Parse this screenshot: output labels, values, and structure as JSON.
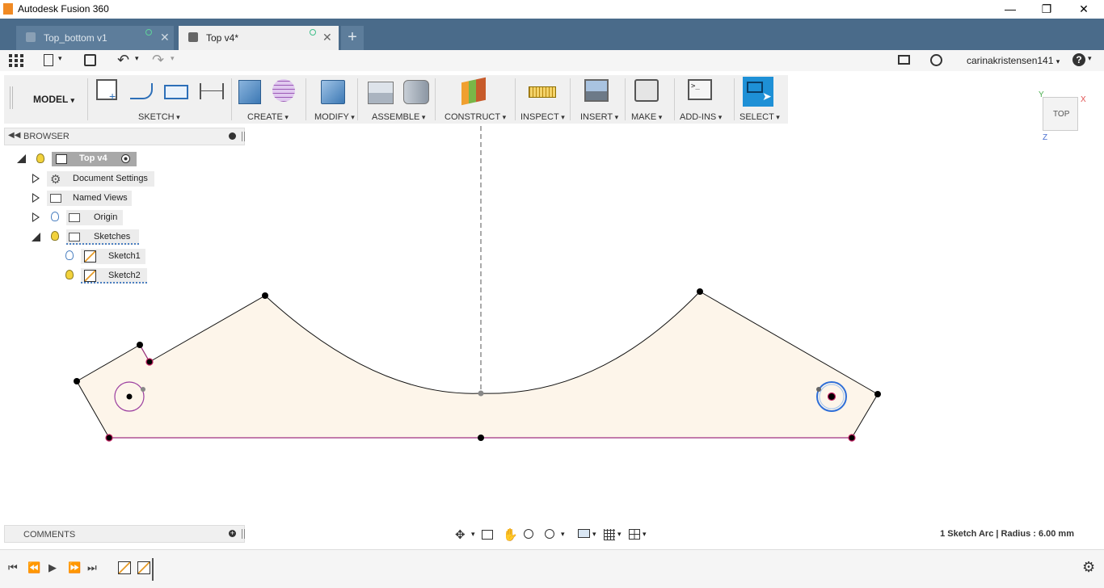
{
  "window": {
    "title": "Autodesk Fusion 360"
  },
  "tabs": [
    {
      "label": "Top_bottom v1",
      "active": false
    },
    {
      "label": "Top v4*",
      "active": true
    }
  ],
  "user": {
    "name": "carinakristensen141"
  },
  "workspace": {
    "label": "MODEL"
  },
  "ribbon": {
    "groups": [
      "SKETCH",
      "CREATE",
      "MODIFY",
      "ASSEMBLE",
      "CONSTRUCT",
      "INSPECT",
      "INSERT",
      "MAKE",
      "ADD-INS",
      "SELECT"
    ]
  },
  "viewcube": {
    "face": "TOP",
    "axis_x": "X",
    "axis_y": "Y",
    "axis_z": "Z"
  },
  "browser": {
    "title": "BROWSER",
    "root": "Top v4",
    "items": [
      "Document Settings",
      "Named Views",
      "Origin",
      "Sketches"
    ],
    "sketches": [
      "Sketch1",
      "Sketch2"
    ]
  },
  "comments": {
    "title": "COMMENTS"
  },
  "status": {
    "text": "1 Sketch Arc | Radius : 6.00 mm"
  },
  "colors": {
    "accent": "#1e90d6",
    "tabbar": "#4a6b8a",
    "sketch_fill": "#fdf5ea"
  },
  "icons": [
    "app-logo-icon",
    "apps-grid-icon",
    "file-icon",
    "save-icon",
    "undo-icon",
    "redo-icon",
    "chat-icon",
    "clock-icon",
    "help-icon",
    "gear-icon"
  ]
}
